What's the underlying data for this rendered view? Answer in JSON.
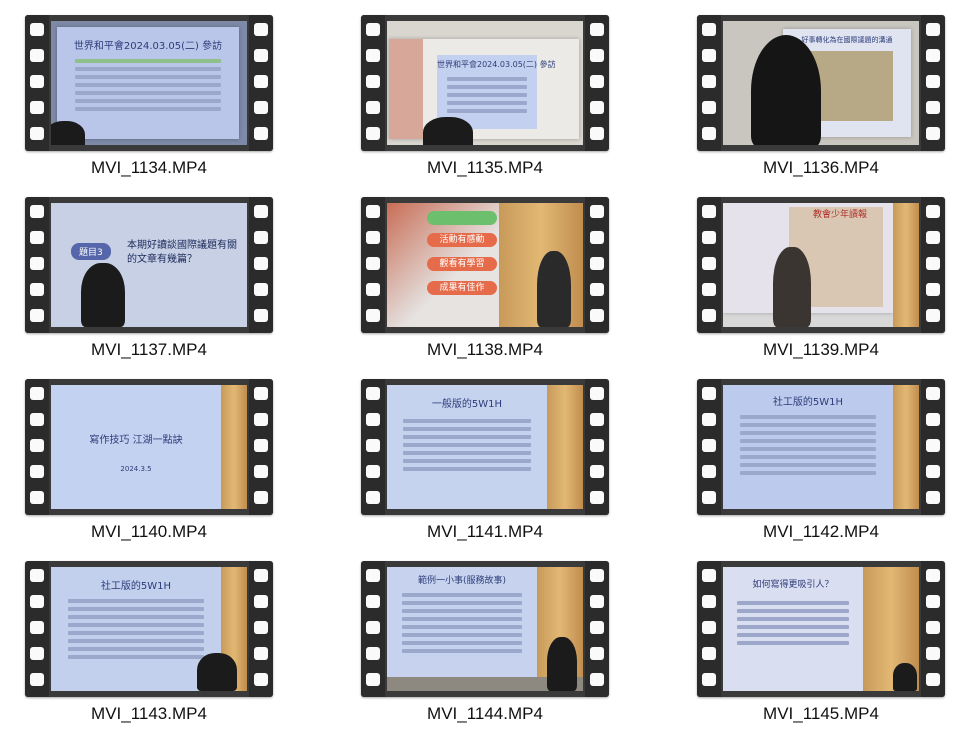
{
  "files": [
    {
      "name": "MVI_1134.MP4",
      "slide_title": "世界和平會2024.03.05(二) 參訪"
    },
    {
      "name": "MVI_1135.MP4",
      "slide_title": "世界和平會2024.03.05(二) 參訪"
    },
    {
      "name": "MVI_1136.MP4",
      "slide_title": "好事轉化為在國際議題的溝通"
    },
    {
      "name": "MVI_1137.MP4",
      "slide_tag": "題目3",
      "slide_text": "本期好讀談國際議題有關的文章有幾篇？"
    },
    {
      "name": "MVI_1138.MP4",
      "bubbles": [
        "活動有感動",
        "觀看有學習",
        "成果有佳作"
      ]
    },
    {
      "name": "MVI_1139.MP4",
      "slide_title": "教會少年讀報"
    },
    {
      "name": "MVI_1140.MP4",
      "slide_title": "寫作技巧 江湖一點訣",
      "slide_sub": "2024.3.5"
    },
    {
      "name": "MVI_1141.MP4",
      "slide_title": "一般版的5W1H"
    },
    {
      "name": "MVI_1142.MP4",
      "slide_title": "社工版的5W1H"
    },
    {
      "name": "MVI_1143.MP4",
      "slide_title": "社工版的5W1H"
    },
    {
      "name": "MVI_1144.MP4",
      "slide_title": "範例一小事(服務故事)"
    },
    {
      "name": "MVI_1145.MP4",
      "slide_title": "如何寫得更吸引人？"
    }
  ],
  "colors": {
    "filmstrip": "#2b2b2b",
    "screen": "#c9d3ee",
    "door": "#d9a862"
  }
}
